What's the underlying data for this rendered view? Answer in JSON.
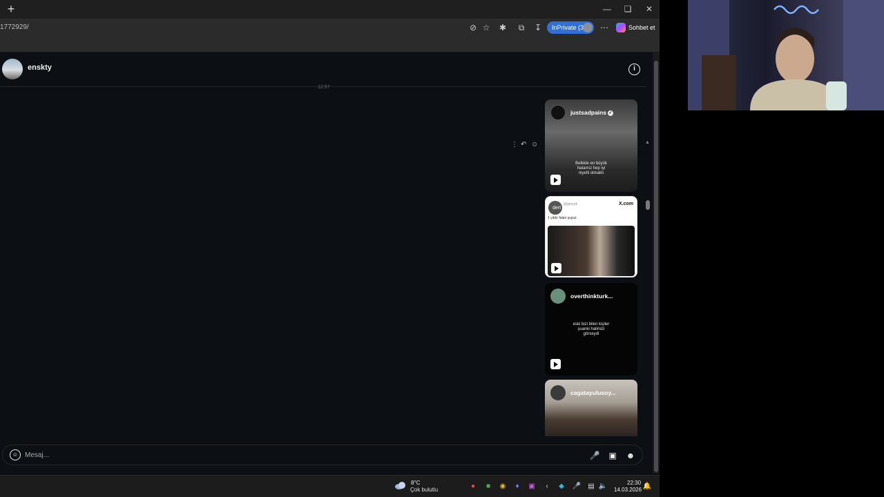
{
  "browser": {
    "url": "1772929/",
    "inprivate_label": "InPrivate (3)",
    "copilot_label": "Sohbet et"
  },
  "chat": {
    "username": "enskty",
    "timestamp": "12:57",
    "cards": [
      {
        "user": "justsadpains",
        "verified": true,
        "caption": "Belkide en büyük hatamız hep iyi niyetli olmaktı",
        "theme": "dark"
      },
      {
        "source": "X.com",
        "tweet_text": "1 yıldır falan şuyuz",
        "overlay_text": "dert",
        "sub_label": "@gerçek",
        "theme": "light"
      },
      {
        "user": "overthinkturk...",
        "caption": "eski bizi bilen kişiler şuanki halimizi görseydi",
        "theme": "black"
      },
      {
        "user": "cagatayulusoy...",
        "theme": "photo"
      }
    ],
    "composer_placeholder": "Mesaj..."
  },
  "taskbar": {
    "weather_temp": "8°C",
    "weather_desc": "Çok bulutlu",
    "time": "22:30",
    "date": "14.03.2026"
  },
  "colors": {
    "accent": "#2f6fd6",
    "background": "#0c1014"
  }
}
